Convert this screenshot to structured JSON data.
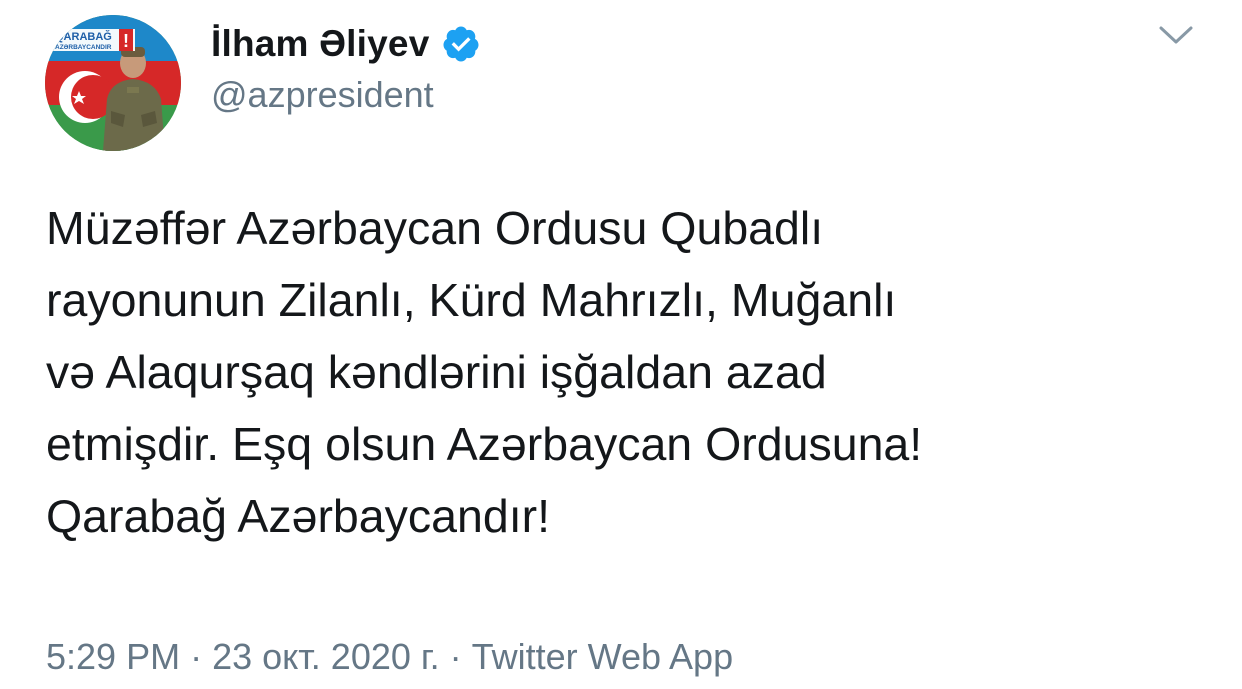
{
  "author": {
    "display_name": "İlham Əliyev",
    "handle": "@azpresident",
    "verified": true,
    "avatar_banner_text_1": "QARABAĞ",
    "avatar_banner_text_2": "AZƏRBAYCANDIR",
    "avatar_banner_mark": "!"
  },
  "tweet": {
    "text": "Müzəffər Azərbaycan Ordusu Qubadlı\nrayonunun Zilanlı, Kürd Mahrızlı, Muğanlı\nvə Alaqurşaq kəndlərini işğaldan azad\netmişdir. Eşq olsun Azərbaycan Ordusuna!\nQarabağ Azərbaycandır!",
    "time": "5:29 PM",
    "date": "23 окт. 2020 г.",
    "separator": "·",
    "source": "Twitter Web App"
  },
  "icons": {
    "verified": "verified-badge-icon",
    "caret": "chevron-down-icon"
  },
  "colors": {
    "text_primary": "#14171a",
    "text_secondary": "#657786",
    "verified_blue": "#1da1f2",
    "background": "#ffffff"
  }
}
